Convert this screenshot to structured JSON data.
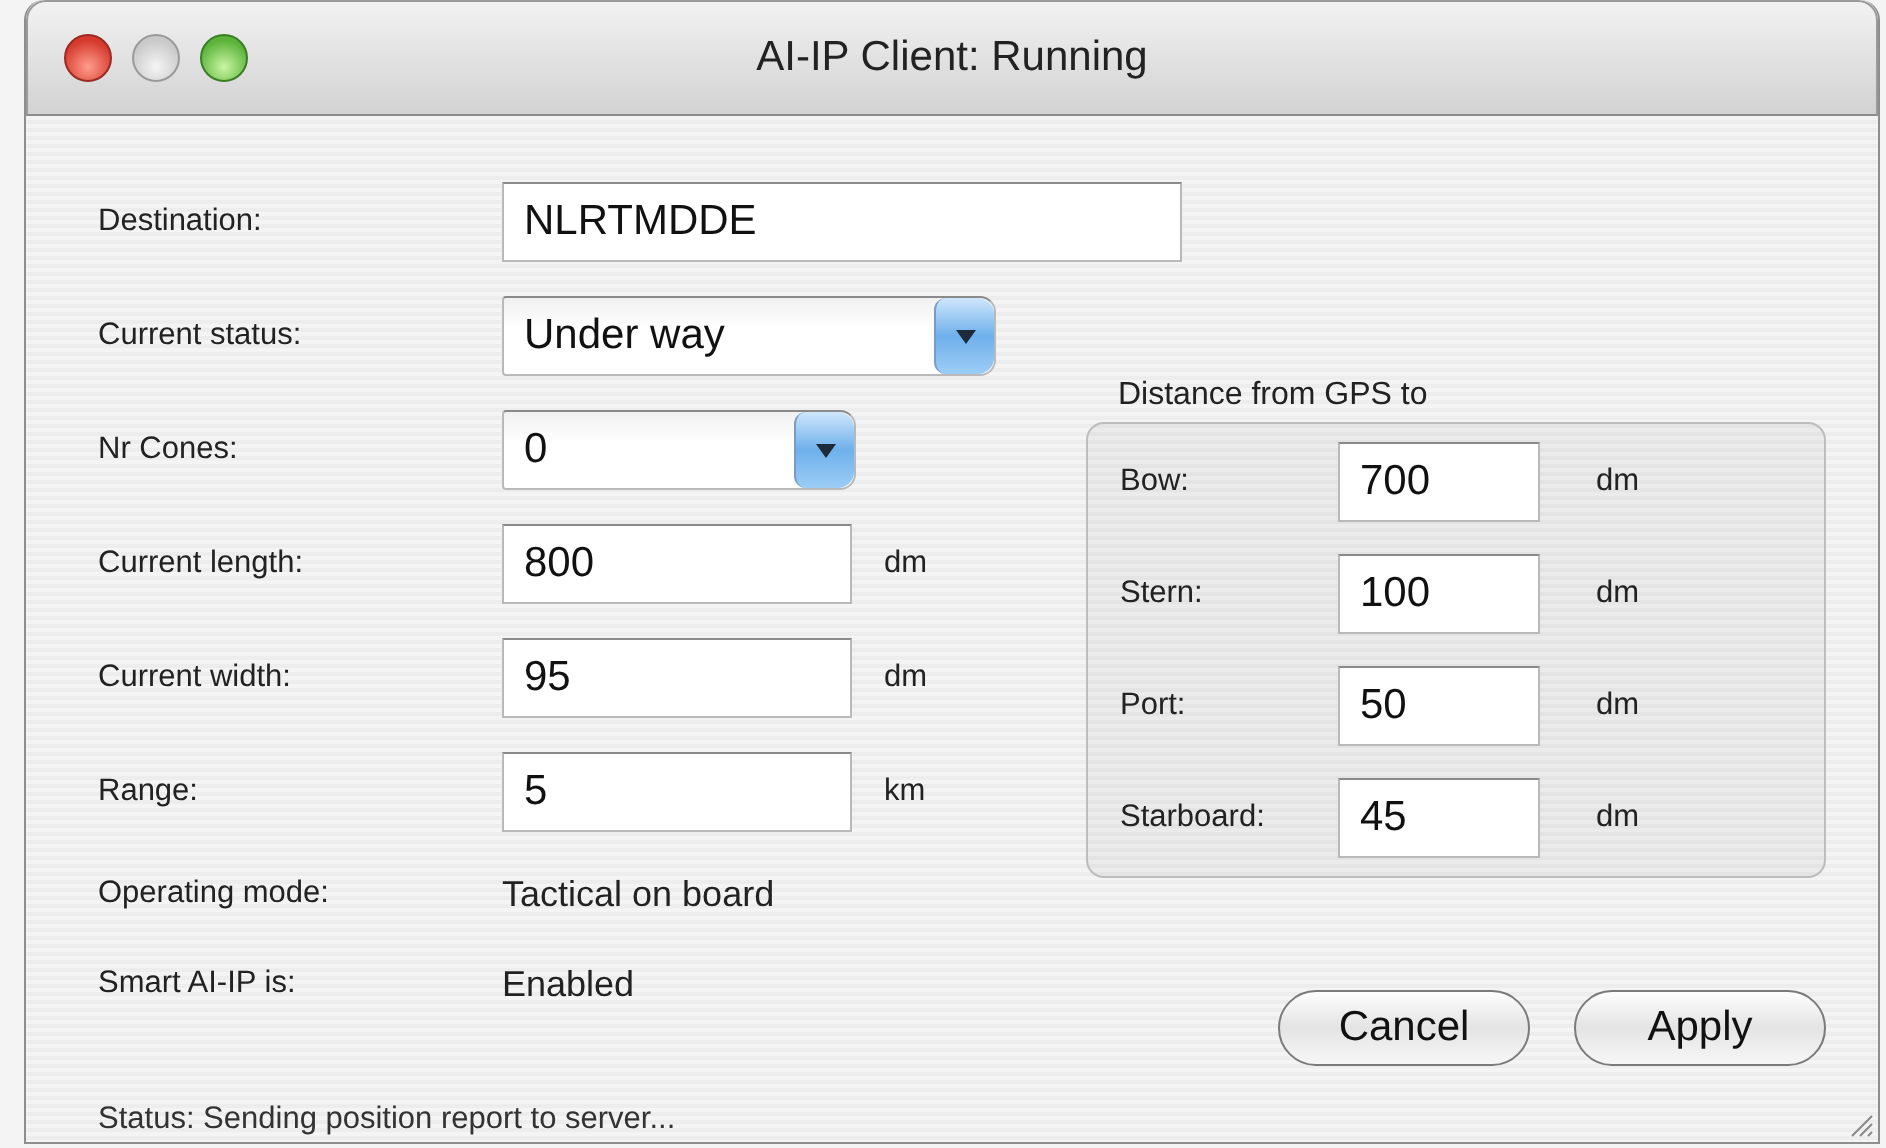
{
  "window": {
    "title": "AI-IP Client: Running"
  },
  "fields": [
    {
      "label": "Destination:",
      "kind": "text",
      "value": "NLRTMDDE"
    },
    {
      "label": "Current status:",
      "kind": "select",
      "value": "Under way"
    },
    {
      "label": "Nr Cones:",
      "kind": "select",
      "value": "0"
    },
    {
      "label": "Current length:",
      "kind": "text",
      "value": "800",
      "unit": "dm"
    },
    {
      "label": "Current width:",
      "kind": "text",
      "value": "95",
      "unit": "dm"
    },
    {
      "label": "Range:",
      "kind": "text",
      "value": "5",
      "unit": "km"
    },
    {
      "label": "Operating mode:",
      "kind": "readout",
      "value": "Tactical on board"
    },
    {
      "label": "Smart AI-IP is:",
      "kind": "readout",
      "value": "Enabled"
    }
  ],
  "gps_distance": {
    "title": "Distance from GPS to",
    "rows": [
      {
        "label": "Bow:",
        "value": "700",
        "unit": "dm"
      },
      {
        "label": "Stern:",
        "value": "100",
        "unit": "dm"
      },
      {
        "label": "Port:",
        "value": "50",
        "unit": "dm"
      },
      {
        "label": "Starboard:",
        "value": "45",
        "unit": "dm"
      }
    ]
  },
  "buttons": [
    "Cancel",
    "Apply"
  ],
  "status_bar": "Status: Sending position report to server..."
}
